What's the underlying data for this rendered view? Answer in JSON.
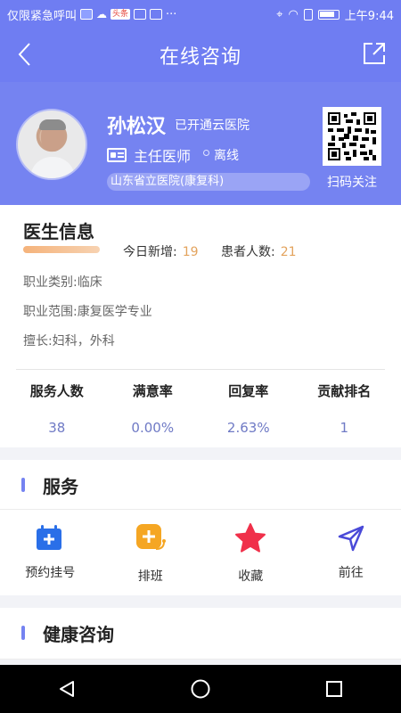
{
  "status_bar": {
    "carrier_text": "仅限紧急呼叫",
    "badge_text": "头条",
    "dots": "···",
    "time": "上午9:44"
  },
  "navbar": {
    "title": "在线咨询"
  },
  "doctor": {
    "name": "孙松汉",
    "open_hospital": "已开通云医院",
    "title": "主任医师",
    "status": "离线",
    "hospital": "山东省立医院(康复科)",
    "qr_label": "扫码关注"
  },
  "info": {
    "section_title": "医生信息",
    "today_new_label": "今日新增:",
    "today_new_value": "19",
    "patients_label": "患者人数:",
    "patients_value": "21",
    "category": "职业类别:临床",
    "scope": "职业范围:康复医学专业",
    "specialty": "擅长:妇科，外科",
    "metrics": [
      {
        "label": "服务人数",
        "value": "38"
      },
      {
        "label": "满意率",
        "value": "0.00%"
      },
      {
        "label": "回复率",
        "value": "2.63%"
      },
      {
        "label": "贡献排名",
        "value": "1"
      }
    ]
  },
  "services": {
    "title": "服务",
    "items": [
      {
        "label": "预约挂号",
        "icon": "calendar-add-icon"
      },
      {
        "label": "排班",
        "icon": "schedule-icon"
      },
      {
        "label": "收藏",
        "icon": "star-icon"
      },
      {
        "label": "前往",
        "icon": "navigate-icon"
      }
    ]
  },
  "consult": {
    "title": "健康咨询"
  },
  "colors": {
    "primary": "#6f7df2",
    "accent": "#e3a35d",
    "metric_value": "#6f7ac5"
  }
}
